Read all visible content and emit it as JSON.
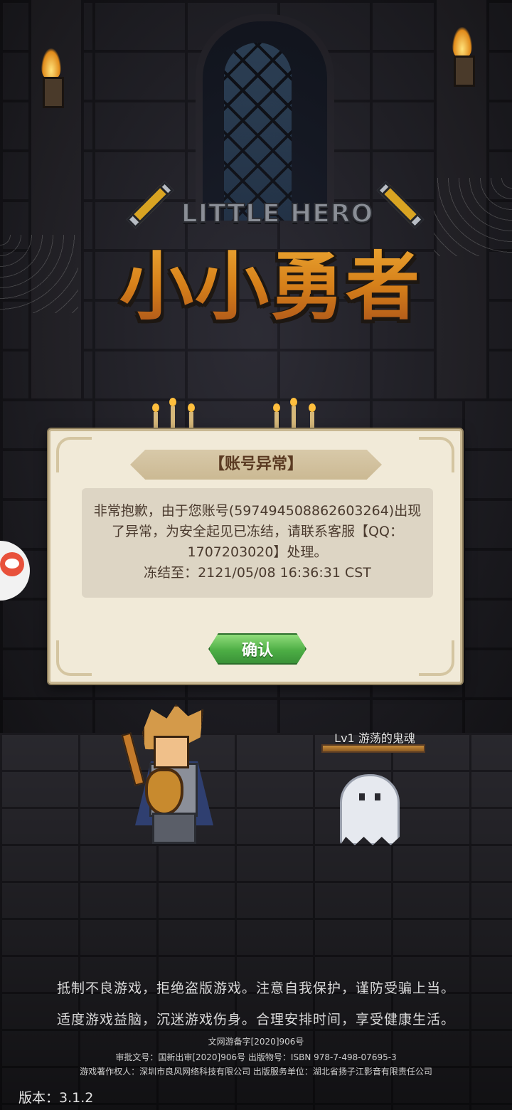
{
  "logo": {
    "subtitle": "LITTLE HERO",
    "title": "小小勇者"
  },
  "dialog": {
    "title": "【账号异常】",
    "message": "非常抱歉，由于您账号(597494508862603264)出现了异常，为安全起见已冻结，请联系客服【QQ：1707203020】处理。",
    "frozen_until": "冻结至：2121/05/08 16:36:31 CST",
    "confirm_label": "确认"
  },
  "enemy": {
    "label": "Lv1 游荡的鬼魂",
    "hp_fraction": 1.0
  },
  "footer": {
    "line1": "抵制不良游戏，拒绝盗版游戏。注意自我保护，谨防受骗上当。",
    "line2": "适度游戏益脑，沉迷游戏伤身。合理安排时间，享受健康生活。",
    "line3": "文网游备字[2020]906号",
    "line4": "审批文号：国新出审[2020]906号 出版物号：ISBN 978-7-498-07695-3",
    "line5": "游戏著作权人：深圳市良风网络科技有限公司 出版服务单位：湖北省扬子江影音有限责任公司",
    "version": "版本：3.1.2"
  },
  "colors": {
    "accent_green": "#4dae45",
    "dialog_bg": "#f1ead8",
    "logo_orange": "#d68f1d"
  }
}
